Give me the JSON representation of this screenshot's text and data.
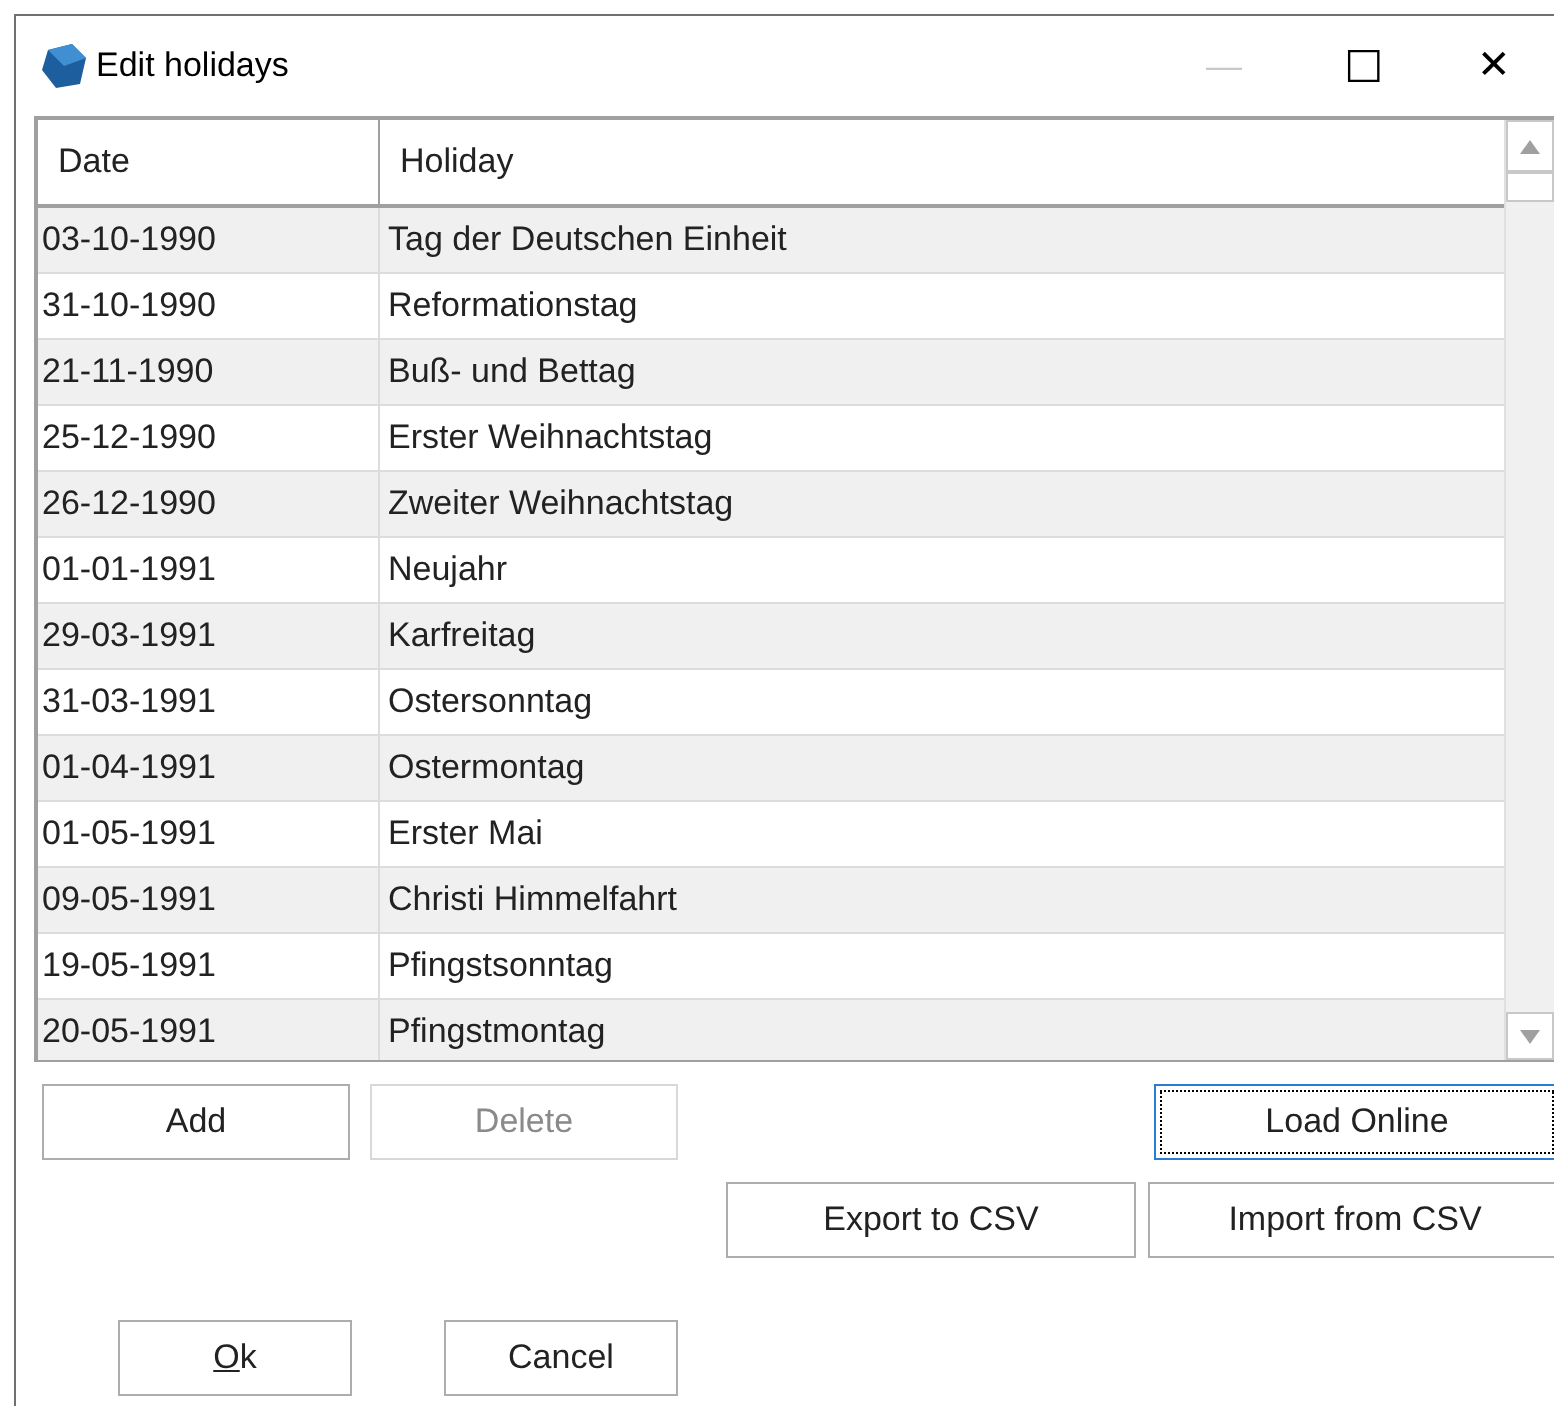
{
  "window": {
    "title": "Edit holidays",
    "controls": [
      "—",
      "☐",
      "✕"
    ]
  },
  "table": {
    "columns": [
      "Date",
      "Holiday"
    ],
    "rows": [
      {
        "date": "03-10-1990",
        "holiday": "Tag der Deutschen Einheit"
      },
      {
        "date": "31-10-1990",
        "holiday": "Reformationstag"
      },
      {
        "date": "21-11-1990",
        "holiday": "Buß- und Bettag"
      },
      {
        "date": "25-12-1990",
        "holiday": "Erster Weihnachtstag"
      },
      {
        "date": "26-12-1990",
        "holiday": "Zweiter Weihnachtstag"
      },
      {
        "date": "01-01-1991",
        "holiday": "Neujahr"
      },
      {
        "date": "29-03-1991",
        "holiday": "Karfreitag"
      },
      {
        "date": "31-03-1991",
        "holiday": "Ostersonntag"
      },
      {
        "date": "01-04-1991",
        "holiday": "Ostermontag"
      },
      {
        "date": "01-05-1991",
        "holiday": "Erster Mai"
      },
      {
        "date": "09-05-1991",
        "holiday": "Christi Himmelfahrt"
      },
      {
        "date": "19-05-1991",
        "holiday": "Pfingstsonntag"
      },
      {
        "date": "20-05-1991",
        "holiday": "Pfingstmontag"
      }
    ]
  },
  "buttons": [
    {
      "label": "Add",
      "disabled": false,
      "focused": false
    },
    {
      "label": "Delete",
      "disabled": true,
      "focused": false
    },
    {
      "label": "Load Online",
      "disabled": false,
      "focused": true
    },
    {
      "label": "Export to CSV",
      "disabled": false,
      "focused": false
    },
    {
      "label": "Import from CSV",
      "disabled": false,
      "focused": false
    }
  ],
  "dialog_buttons": [
    {
      "label": "Ok",
      "access_key": true
    },
    {
      "label": "Cancel",
      "access_key": false
    }
  ]
}
